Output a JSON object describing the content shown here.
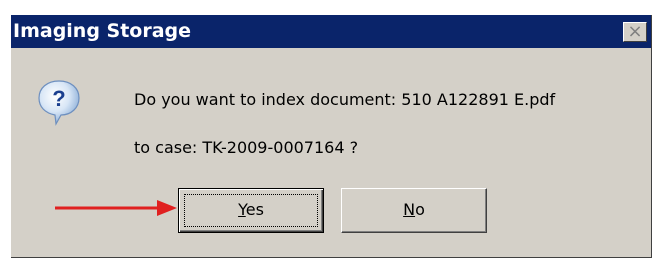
{
  "window": {
    "title": "Imaging Storage",
    "close_glyph": "×"
  },
  "message": {
    "line1": "Do you want to index document: 510 A122891 E.pdf",
    "line2": "to case: TK-2009-0007164 ?"
  },
  "buttons": {
    "yes": {
      "mnemonic": "Y",
      "rest": "es"
    },
    "no": {
      "mnemonic": "N",
      "rest": "o"
    }
  },
  "icons": {
    "question": "question-icon",
    "arrow": "arrow-annotation"
  },
  "colors": {
    "titlebar": "#0a246a",
    "dialog_bg": "#d4d0c8",
    "arrow": "#e02020"
  }
}
